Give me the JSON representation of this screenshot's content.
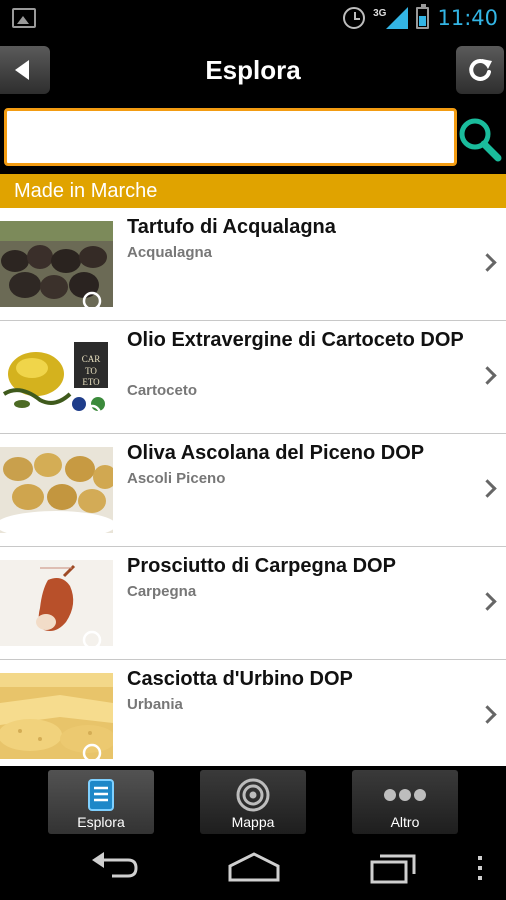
{
  "status_bar": {
    "network": "3G",
    "time": "11:40"
  },
  "header": {
    "title": "Esplora"
  },
  "search": {
    "value": "",
    "placeholder": ""
  },
  "section": {
    "title": "Made in Marche"
  },
  "items": [
    {
      "title": "Tartufo di Acqualagna",
      "subtitle": "Acqualagna"
    },
    {
      "title": "Olio Extravergine di Cartoceto DOP",
      "subtitle": "Cartoceto"
    },
    {
      "title": "Oliva Ascolana del Piceno DOP",
      "subtitle": "Ascoli Piceno"
    },
    {
      "title": "Prosciutto di Carpegna DOP",
      "subtitle": "Carpegna"
    },
    {
      "title": "Casciotta d'Urbino DOP",
      "subtitle": "Urbania"
    }
  ],
  "tabs": [
    {
      "label": "Esplora",
      "active": true,
      "icon": "list-icon"
    },
    {
      "label": "Mappa",
      "active": false,
      "icon": "target-icon"
    },
    {
      "label": "Altro",
      "active": false,
      "icon": "more-icon"
    }
  ],
  "colors": {
    "accent": "#33b5e5",
    "section": "#e0a300",
    "search_border": "#f39c12",
    "search_icon": "#1abc9c"
  }
}
